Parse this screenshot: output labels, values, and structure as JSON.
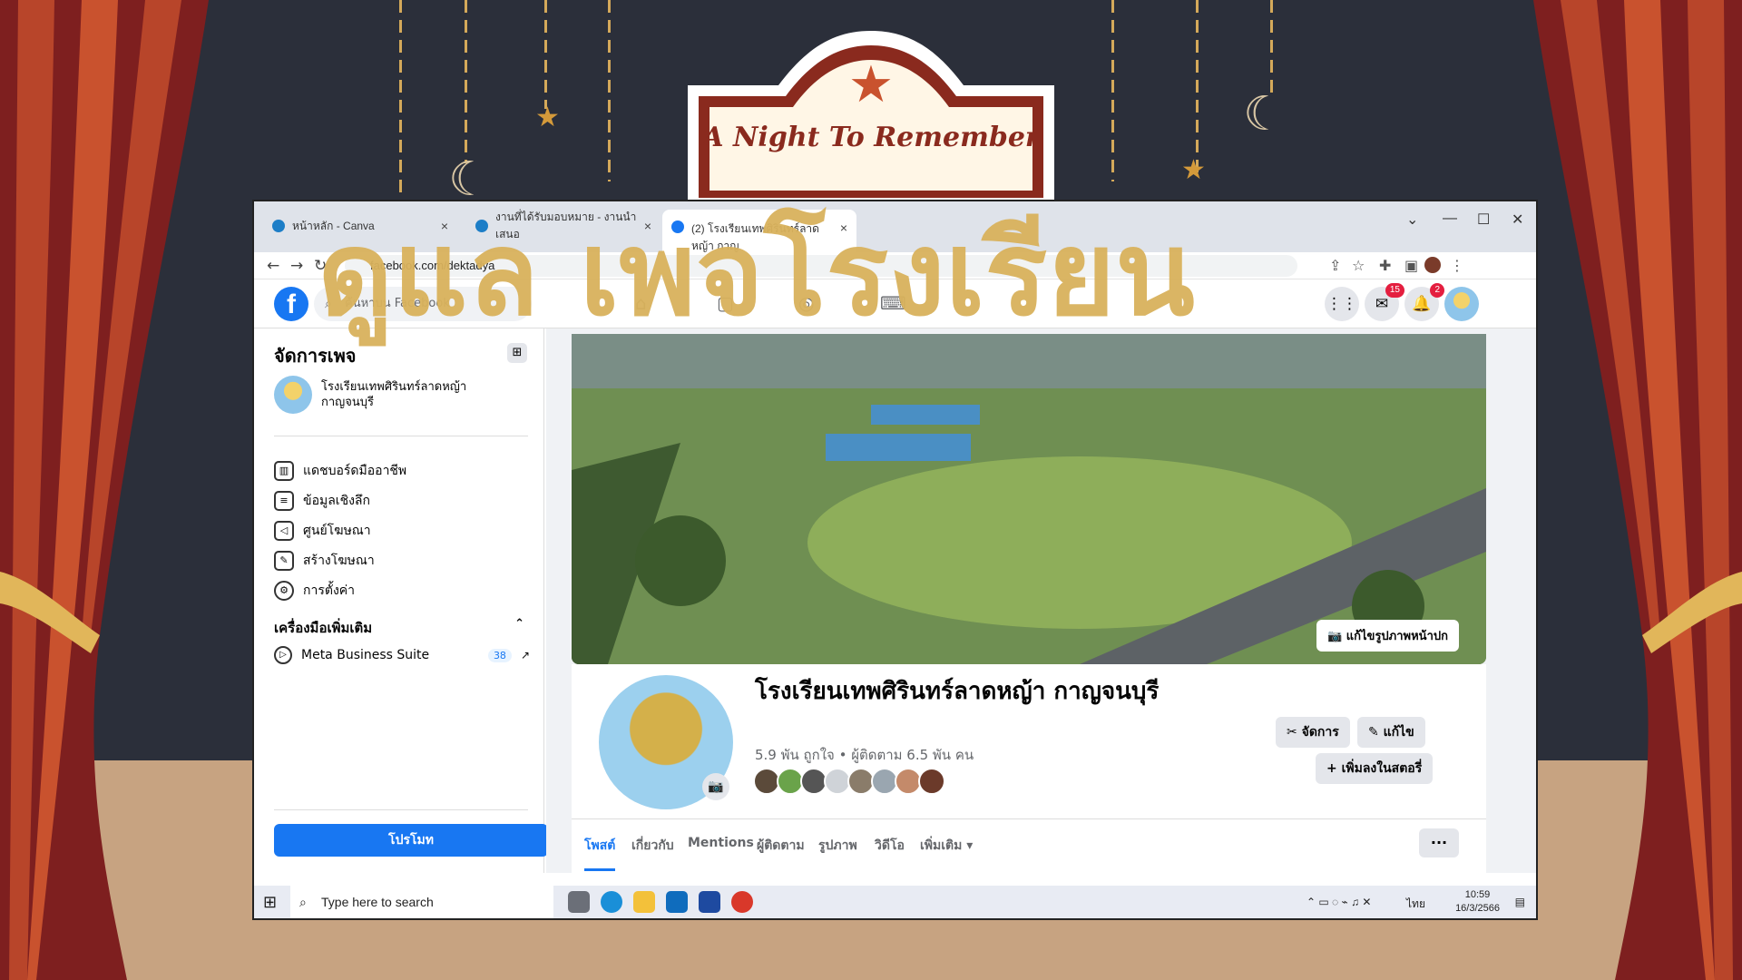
{
  "sign": {
    "title": "A Night To Remember"
  },
  "overlay_title": "ดูแล เพจโรงเรียน",
  "browser": {
    "tabs": [
      {
        "label": "หน้าหลัก - Canva",
        "close": "×"
      },
      {
        "label": "งานที่ได้รับมอบหมาย - งานนำเสนอ",
        "close": "×"
      },
      {
        "label": "(2) โรงเรียนเทพศิรินทร์ลาดหญ้า กาญ",
        "close": "×"
      }
    ],
    "window_controls": {
      "chevron": "⌄",
      "minimize": "—",
      "maximize": "☐",
      "close": "✕"
    },
    "nav": {
      "back": "←",
      "forward": "→",
      "reload": "↻"
    },
    "url": "facebook.com/dektadya"
  },
  "facebook": {
    "logo": "f",
    "search_placeholder": "ค้นหาบน Facebook",
    "messenger_badge": "15",
    "notif_badge": "2"
  },
  "sidebar": {
    "title": "จัดการเพจ",
    "page_name": "โรงเรียนเทพศิรินทร์ลาดหญ้า กาญจนบุรี",
    "items": [
      {
        "label": "แดชบอร์ดมืออาชีพ",
        "icon": "dashboard-icon"
      },
      {
        "label": "ข้อมูลเชิงลึก",
        "icon": "insights-icon"
      },
      {
        "label": "ศูนย์โฆษณา",
        "icon": "megaphone-icon"
      },
      {
        "label": "สร้างโฆษณา",
        "icon": "edit-icon"
      },
      {
        "label": "การตั้งค่า",
        "icon": "gear-icon"
      }
    ],
    "tools_section": "เครื่องมือเพิ่มเติม",
    "mbs_label": "Meta Business Suite",
    "mbs_count": "38",
    "promote": "โปรโมท"
  },
  "profile": {
    "edit_cover": "แก้ไขรูปภาพหน้าปก",
    "name": "โรงเรียนเทพศิรินทร์ลาดหญ้า กาญจนบุรี",
    "stats": "5.9 พัน ถูกใจ • ผู้ติดตาม 6.5 พัน คน",
    "manage_btn": "จัดการ",
    "edit_btn": "แก้ไข",
    "add_story_btn": "เพิ่มลงในสตอรี่",
    "tabs": [
      "โพสต์",
      "เกี่ยวกับ",
      "Mentions",
      "ผู้ติดตาม",
      "รูปภาพ",
      "วิดีโอ",
      "เพิ่มเติม ▾"
    ],
    "more": "···"
  },
  "taskbar": {
    "search_placeholder": "Type here to search",
    "lang": "ไทย",
    "time": "10:59",
    "date": "16/3/2566"
  }
}
